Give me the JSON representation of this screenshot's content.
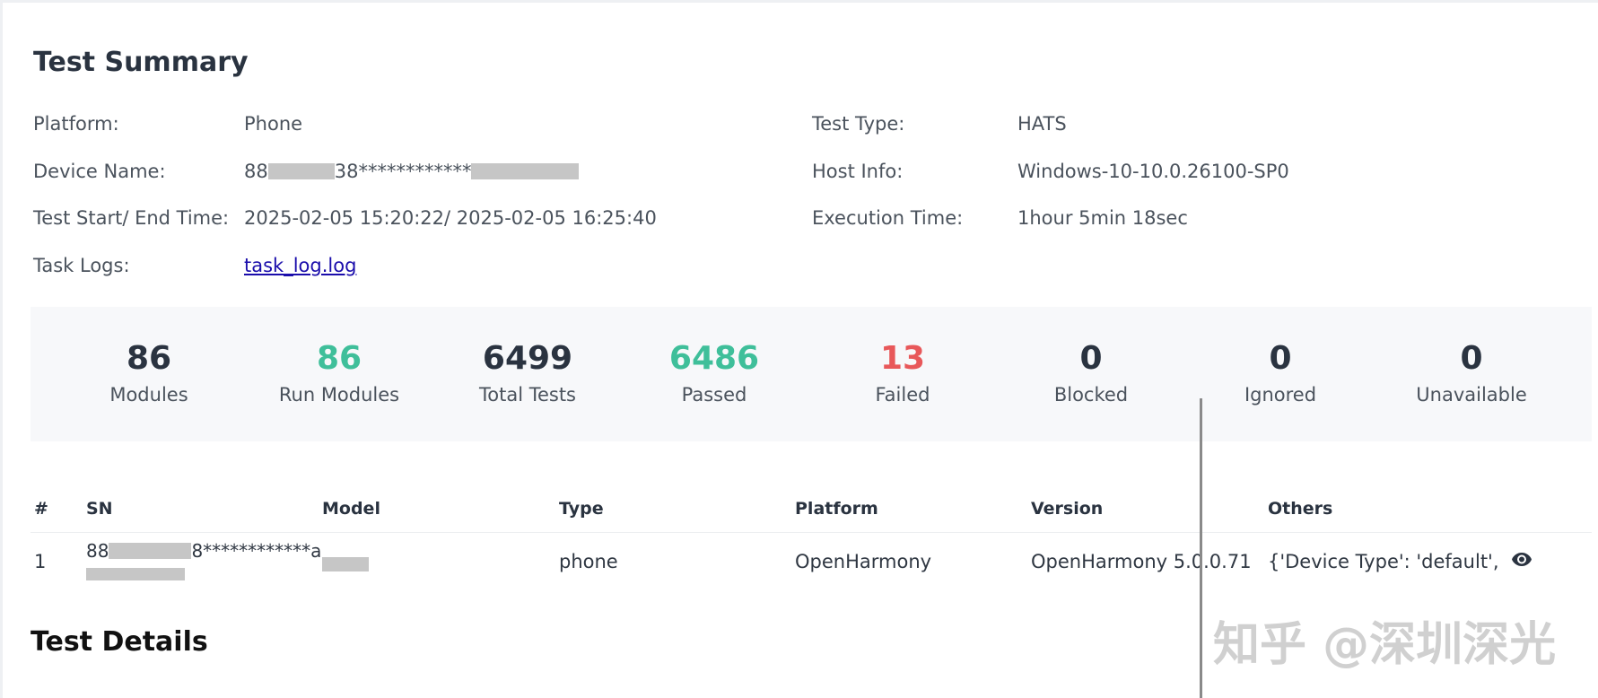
{
  "summary": {
    "title": "Test Summary",
    "platform_label": "Platform:",
    "platform_value": "Phone",
    "test_type_label": "Test Type:",
    "test_type_value": "HATS",
    "device_name_label": "Device Name:",
    "device_name_prefix": "88",
    "device_name_mid": "38************",
    "host_info_label": "Host Info:",
    "host_info_value": "Windows-10-10.0.26100-SP0",
    "time_label": "Test Start/ End Time:",
    "time_value": "2025-02-05 15:20:22/ 2025-02-05 16:25:40",
    "exec_label": "Execution Time:",
    "exec_value": "1hour 5min 18sec",
    "logs_label": "Task Logs:",
    "logs_link": "task_log.log"
  },
  "stats": [
    {
      "value": "86",
      "label": "Modules"
    },
    {
      "value": "86",
      "label": "Run Modules"
    },
    {
      "value": "6499",
      "label": "Total Tests"
    },
    {
      "value": "6486",
      "label": "Passed"
    },
    {
      "value": "13",
      "label": "Failed"
    },
    {
      "value": "0",
      "label": "Blocked"
    },
    {
      "value": "0",
      "label": "Ignored"
    },
    {
      "value": "0",
      "label": "Unavailable"
    }
  ],
  "colors": {
    "passed": "#3fbf9a",
    "failed": "#e8585a"
  },
  "devices": {
    "columns": [
      "#",
      "SN",
      "Model",
      "Type",
      "Platform",
      "Version",
      "Others"
    ],
    "rows": [
      {
        "index": "1",
        "sn_prefix": "88",
        "sn_mid": "8************a",
        "type": "phone",
        "platform": "OpenHarmony",
        "version": "OpenHarmony 5.0.0.71",
        "others": "{'Device Type': 'default', '...",
        "view_icon": "eye-icon"
      }
    ]
  },
  "details": {
    "title": "Test Details"
  },
  "watermark": "知乎 @深圳深光"
}
